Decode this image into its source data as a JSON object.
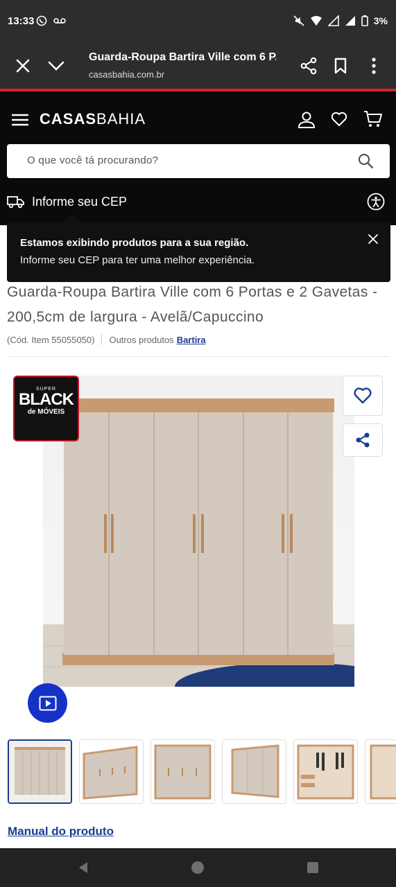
{
  "status_bar": {
    "time": "13:33",
    "battery": "3%"
  },
  "browser": {
    "page_title": "Guarda-Roupa Bartira Ville com 6 P...",
    "domain": "casasbahia.com.br"
  },
  "header": {
    "logo_bold": "CASAS",
    "logo_regular": "BAHIA",
    "search_placeholder": "O que você tá procurando?",
    "cep_label": "Informe seu CEP"
  },
  "tooltip": {
    "title": "Estamos exibindo produtos para a sua região.",
    "text": "Informe seu CEP para ter uma melhor experiência."
  },
  "product": {
    "title": "Guarda-Roupa Bartira Ville com 6 Portas e 2 Gavetas - 200,5cm de largura - Avelã/Capuccino",
    "item_code": "(Cód. Item 55055050)",
    "other_products_label": "Outros produtos",
    "brand": "Bartira",
    "badge": {
      "small": "SUPER",
      "big": "BLACK",
      "sub": "de MÓVEIS"
    },
    "manual_link": "Manual do produto"
  },
  "colors": {
    "brand_blue": "#1a3d8f",
    "video_blue": "#1532c8",
    "accent_red": "#d8202f",
    "header_bg": "#0a0a0a"
  }
}
